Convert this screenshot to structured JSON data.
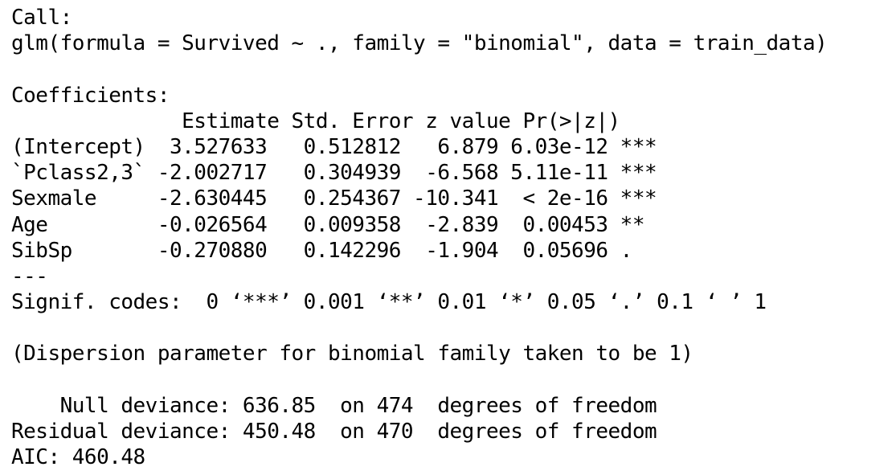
{
  "output": {
    "lines": [
      "Call:",
      "glm(formula = Survived ~ ., family = \"binomial\", data = train_data)",
      "",
      "Coefficients:",
      "              Estimate Std. Error z value Pr(>|z|)    ",
      "(Intercept)  3.527633   0.512812   6.879 6.03e-12 ***",
      "`Pclass2,3` -2.002717   0.304939  -6.568 5.11e-11 ***",
      "Sexmale     -2.630445   0.254367 -10.341  < 2e-16 ***",
      "Age         -0.026564   0.009358  -2.839  0.00453 ** ",
      "SibSp       -0.270880   0.142296  -1.904  0.05696 .  ",
      "---",
      "Signif. codes:  0 ‘***’ 0.001 ‘**’ 0.01 ‘*’ 0.05 ‘.’ 0.1 ‘ ’ 1",
      "",
      "(Dispersion parameter for binomial family taken to be 1)",
      "",
      "    Null deviance: 636.85  on 474  degrees of freedom",
      "Residual deviance: 450.48  on 470  degrees of freedom",
      "AIC: 460.48"
    ]
  }
}
